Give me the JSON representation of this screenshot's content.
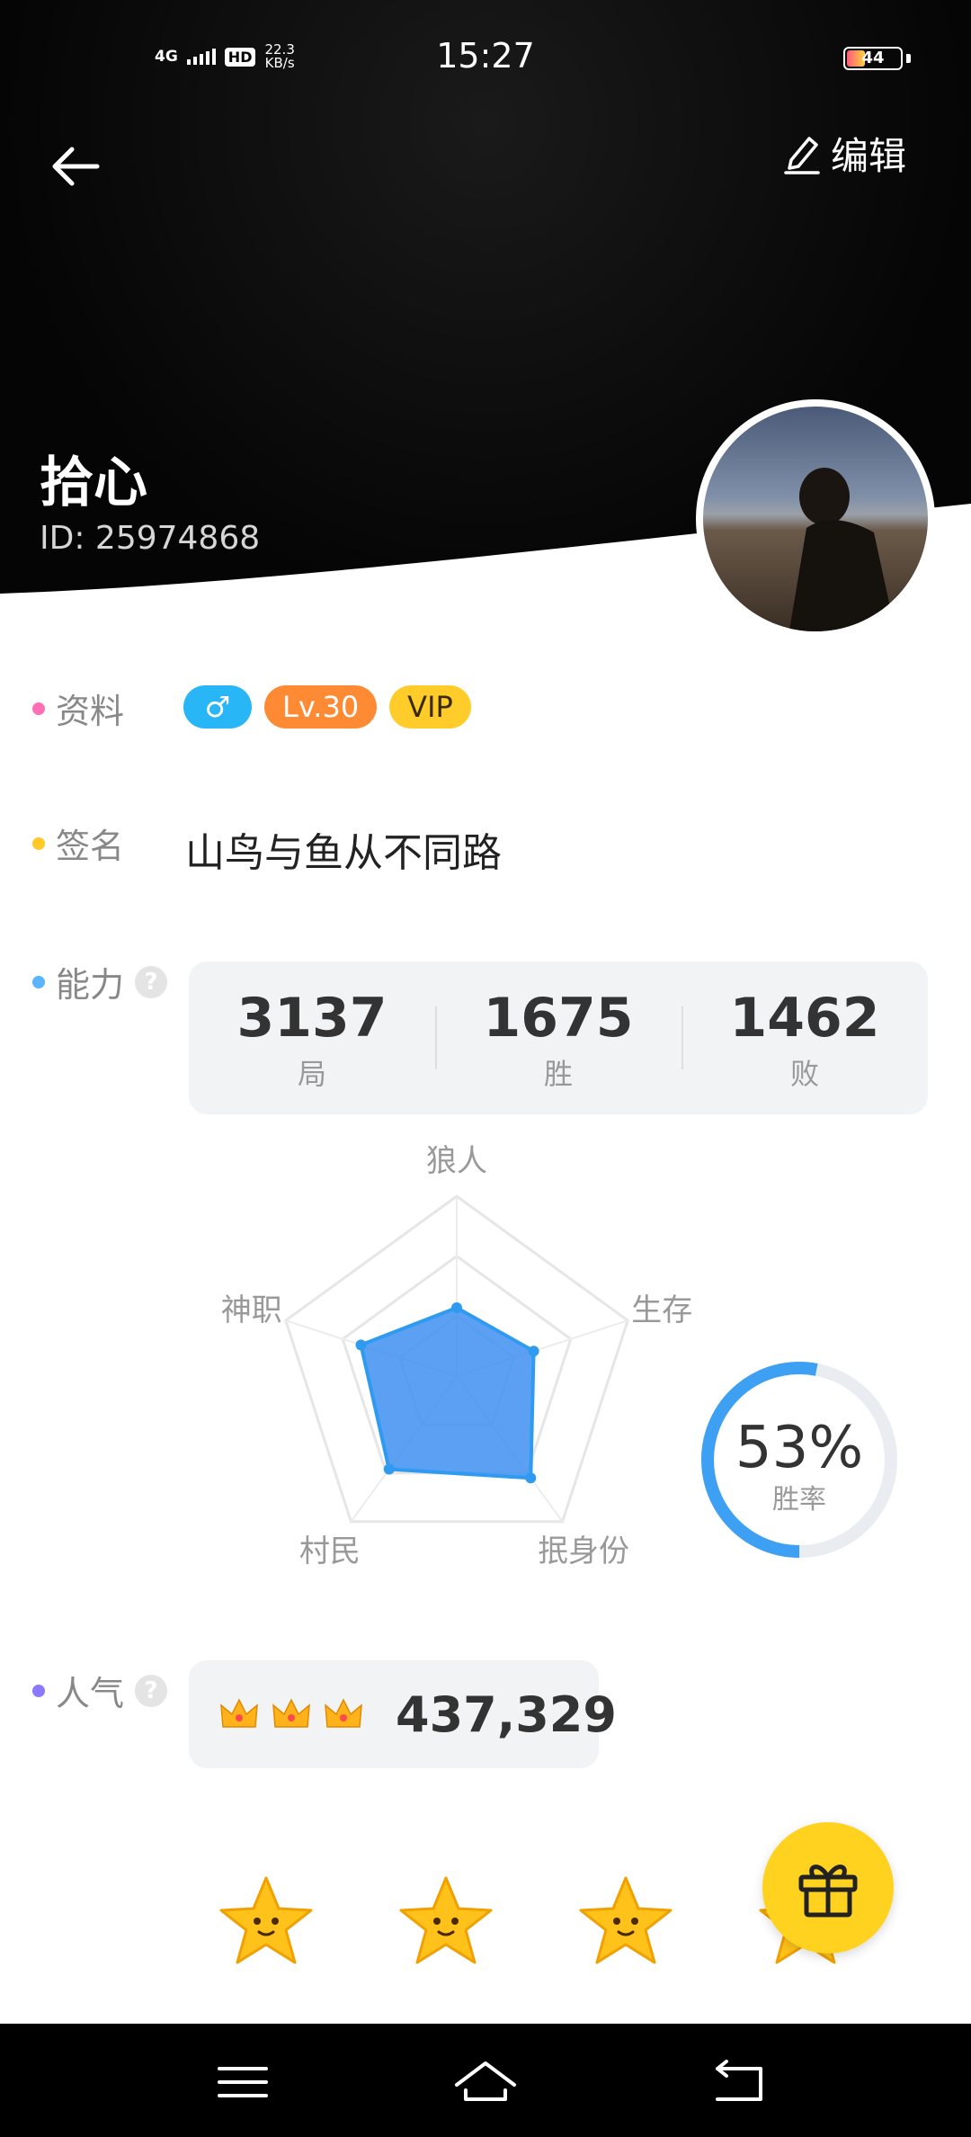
{
  "status_bar": {
    "network": "4G",
    "hd": "HD",
    "speed_value": "22.3",
    "speed_unit": "KB/s",
    "time": "15:27",
    "battery": "44"
  },
  "header": {
    "edit_label": "编辑",
    "nickname": "拾心",
    "user_id": "ID: 25974868"
  },
  "profile": {
    "label": "资料",
    "gender_symbol": "♂",
    "level": "Lv.30",
    "vip": "VIP"
  },
  "signature": {
    "label": "签名",
    "text": "山鸟与鱼从不同路"
  },
  "ability": {
    "label": "能力",
    "help": "?",
    "stats": [
      {
        "value": "3137",
        "label": "局"
      },
      {
        "value": "1675",
        "label": "胜"
      },
      {
        "value": "1462",
        "label": "败"
      }
    ],
    "radar": {
      "axes": [
        "狼人",
        "生存",
        "抿身份",
        "村民",
        "神职"
      ],
      "values": [
        0.38,
        0.45,
        0.7,
        0.64,
        0.56
      ]
    },
    "win_rate": {
      "value": "53%",
      "label": "胜率",
      "fraction": 0.53
    }
  },
  "popularity": {
    "label": "人气",
    "help": "?",
    "value": "437,329"
  },
  "colors": {
    "profile_dot": "#ff6fb5",
    "signature_dot": "#ffc928",
    "ability_dot": "#5ab4ff",
    "popularity_dot": "#8a78ff",
    "accent_blue": "#3ea0f2",
    "gift_yellow": "#ffd21f"
  },
  "icons": {
    "back": "back-arrow-icon",
    "edit": "edit-pencil-icon",
    "gift": "gift-icon",
    "crown": "crown-icon",
    "star": "star-mascot-icon",
    "nav_menu": "menu-icon",
    "nav_home": "home-icon",
    "nav_back": "return-icon"
  }
}
